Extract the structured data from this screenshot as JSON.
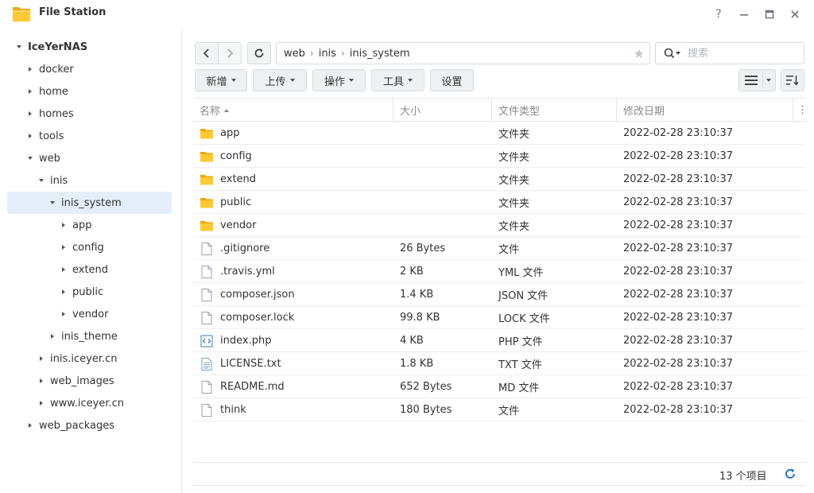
{
  "window": {
    "title": "File Station"
  },
  "sidebar": {
    "items": [
      {
        "label": "IceYerNAS",
        "level": 0,
        "state": "expanded",
        "root": true
      },
      {
        "label": "docker",
        "level": 1,
        "state": "collapsed"
      },
      {
        "label": "home",
        "level": 1,
        "state": "collapsed"
      },
      {
        "label": "homes",
        "level": 1,
        "state": "collapsed"
      },
      {
        "label": "tools",
        "level": 1,
        "state": "collapsed"
      },
      {
        "label": "web",
        "level": 1,
        "state": "expanded"
      },
      {
        "label": "inis",
        "level": 2,
        "state": "expanded"
      },
      {
        "label": "inis_system",
        "level": 3,
        "state": "expanded",
        "selected": true
      },
      {
        "label": "app",
        "level": 4,
        "state": "collapsed"
      },
      {
        "label": "config",
        "level": 4,
        "state": "collapsed"
      },
      {
        "label": "extend",
        "level": 4,
        "state": "collapsed"
      },
      {
        "label": "public",
        "level": 4,
        "state": "collapsed"
      },
      {
        "label": "vendor",
        "level": 4,
        "state": "collapsed"
      },
      {
        "label": "inis_theme",
        "level": 3,
        "state": "collapsed"
      },
      {
        "label": "inis.iceyer.cn",
        "level": 2,
        "state": "collapsed"
      },
      {
        "label": "web_images",
        "level": 2,
        "state": "collapsed"
      },
      {
        "label": "www.iceyer.cn",
        "level": 2,
        "state": "collapsed"
      },
      {
        "label": "web_packages",
        "level": 1,
        "state": "collapsed"
      }
    ]
  },
  "path": {
    "segments": [
      "web",
      "inis",
      "inis_system"
    ]
  },
  "search": {
    "placeholder": "搜索"
  },
  "toolbar": {
    "create": "新增",
    "upload": "上传",
    "action": "操作",
    "tools": "工具",
    "settings": "设置"
  },
  "table": {
    "columns": {
      "name": "名称",
      "size": "大小",
      "type": "文件类型",
      "date": "修改日期"
    },
    "rows": [
      {
        "name": "app",
        "size": "",
        "type": "文件夹",
        "date": "2022-02-28 23:10:37",
        "icon": "folder-icon"
      },
      {
        "name": "config",
        "size": "",
        "type": "文件夹",
        "date": "2022-02-28 23:10:37",
        "icon": "folder-icon"
      },
      {
        "name": "extend",
        "size": "",
        "type": "文件夹",
        "date": "2022-02-28 23:10:37",
        "icon": "folder-icon"
      },
      {
        "name": "public",
        "size": "",
        "type": "文件夹",
        "date": "2022-02-28 23:10:37",
        "icon": "folder-icon"
      },
      {
        "name": "vendor",
        "size": "",
        "type": "文件夹",
        "date": "2022-02-28 23:10:37",
        "icon": "folder-icon"
      },
      {
        "name": ".gitignore",
        "size": "26 Bytes",
        "type": "文件",
        "date": "2022-02-28 23:10:37",
        "icon": "file-icon"
      },
      {
        "name": ".travis.yml",
        "size": "2 KB",
        "type": "YML 文件",
        "date": "2022-02-28 23:10:37",
        "icon": "file-icon"
      },
      {
        "name": "composer.json",
        "size": "1.4 KB",
        "type": "JSON 文件",
        "date": "2022-02-28 23:10:37",
        "icon": "file-icon"
      },
      {
        "name": "composer.lock",
        "size": "99.8 KB",
        "type": "LOCK 文件",
        "date": "2022-02-28 23:10:37",
        "icon": "file-icon"
      },
      {
        "name": "index.php",
        "size": "4 KB",
        "type": "PHP 文件",
        "date": "2022-02-28 23:10:37",
        "icon": "code-file-icon"
      },
      {
        "name": "LICENSE.txt",
        "size": "1.8 KB",
        "type": "TXT 文件",
        "date": "2022-02-28 23:10:37",
        "icon": "text-file-icon"
      },
      {
        "name": "README.md",
        "size": "652 Bytes",
        "type": "MD 文件",
        "date": "2022-02-28 23:10:37",
        "icon": "file-icon"
      },
      {
        "name": "think",
        "size": "180 Bytes",
        "type": "文件",
        "date": "2022-02-28 23:10:37",
        "icon": "file-icon"
      }
    ]
  },
  "footer": {
    "count": "13 个项目"
  },
  "colors": {
    "accent": "#1a6fd4",
    "folder": "#f7b500",
    "selected": "#e4eef9"
  }
}
